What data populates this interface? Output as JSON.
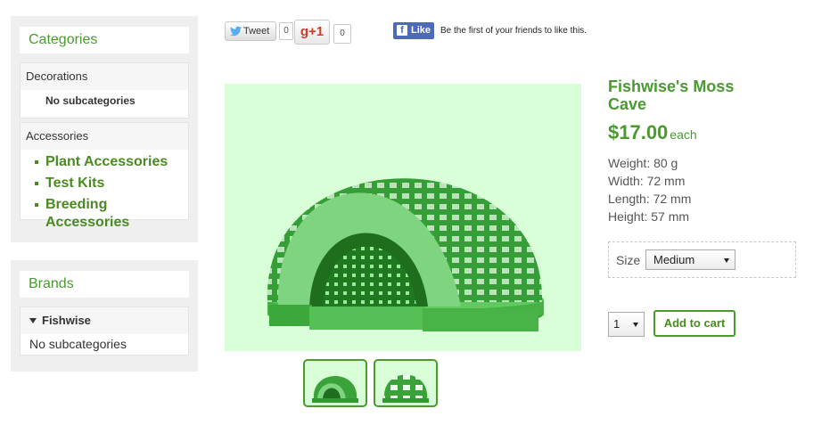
{
  "sidebar": {
    "categories_title": "Categories",
    "categories": [
      {
        "name": "Decorations",
        "empty_text": "No subcategories"
      },
      {
        "name": "Accessories",
        "items": [
          "Plant Accessories",
          "Test Kits",
          "Breeding Accessories"
        ]
      }
    ],
    "brands_title": "Brands",
    "brand": {
      "name": "Fishwise",
      "empty_text": "No subcategories"
    }
  },
  "social": {
    "tweet_label": "Tweet",
    "tweet_count": "0",
    "gplus_label": "g+1",
    "gplus_count": "0",
    "fb_label": "Like",
    "fb_text": "Be the first of your friends to like this."
  },
  "product": {
    "title": "Fishwise's Moss Cave",
    "price": "$17.00",
    "price_unit": "each",
    "specs": [
      "Weight: 80 g",
      "Width: 72 mm",
      "Length: 72 mm",
      "Height: 57 mm"
    ],
    "option_label": "Size",
    "option_value": "Medium",
    "quantity": "1",
    "add_to_cart": "Add to cart"
  },
  "colors": {
    "accent": "#4a9a2f",
    "image_background": "#d9ffd9"
  },
  "icons": [
    "twitter-bird-icon",
    "facebook-icon",
    "caret-down-icon",
    "bullet-icon"
  ]
}
